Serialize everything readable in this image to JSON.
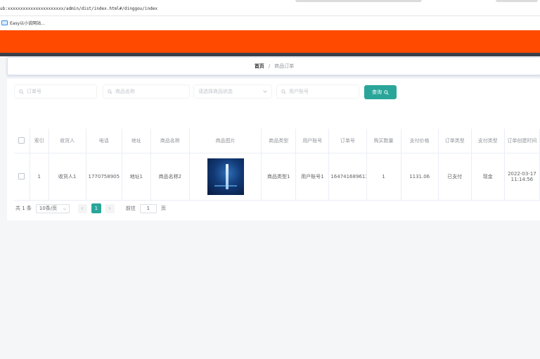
{
  "browser": {
    "url": "ub:xxxxxxxxxxxxxxxxxxxxxx/admin/dist/index.html#/dinggou/index",
    "bookmark": "Easy以小说网站..."
  },
  "breadcrumb": {
    "home": "首页",
    "separator": "/",
    "current": "商品订单"
  },
  "filters": {
    "order_placeholder": "订单号",
    "goods_placeholder": "商品名称",
    "status_placeholder": "请选择商品状态",
    "user_placeholder": "用户账号",
    "search_label": "查询"
  },
  "table": {
    "headers": [
      "",
      "索引",
      "收货人",
      "电话",
      "地址",
      "商品名称",
      "商品图片",
      "商品类型",
      "用户账号",
      "订单号",
      "购买数量",
      "支付价格",
      "订单类型",
      "支付类型",
      "订单创建时间"
    ],
    "rows": [
      {
        "index": "1",
        "receiver": "收货人1",
        "phone": "1770758905",
        "address": "地址1",
        "goods_name": "商品名称2",
        "goods_type": "商品类型1",
        "user": "用户账号1",
        "order_no": "1647416896130",
        "qty": "1",
        "price": "1131.06",
        "order_type": "已支付",
        "pay_type": "现金",
        "created": "2022-03-17 11:14:56"
      }
    ]
  },
  "pagination": {
    "total": "共 1 条",
    "page_size": "10条/页",
    "current_page": "1",
    "goto_label": "前往",
    "goto_value": "1",
    "page_suffix": "页"
  },
  "colors": {
    "brand": "#ff4a00",
    "accent": "#2aa59a"
  }
}
